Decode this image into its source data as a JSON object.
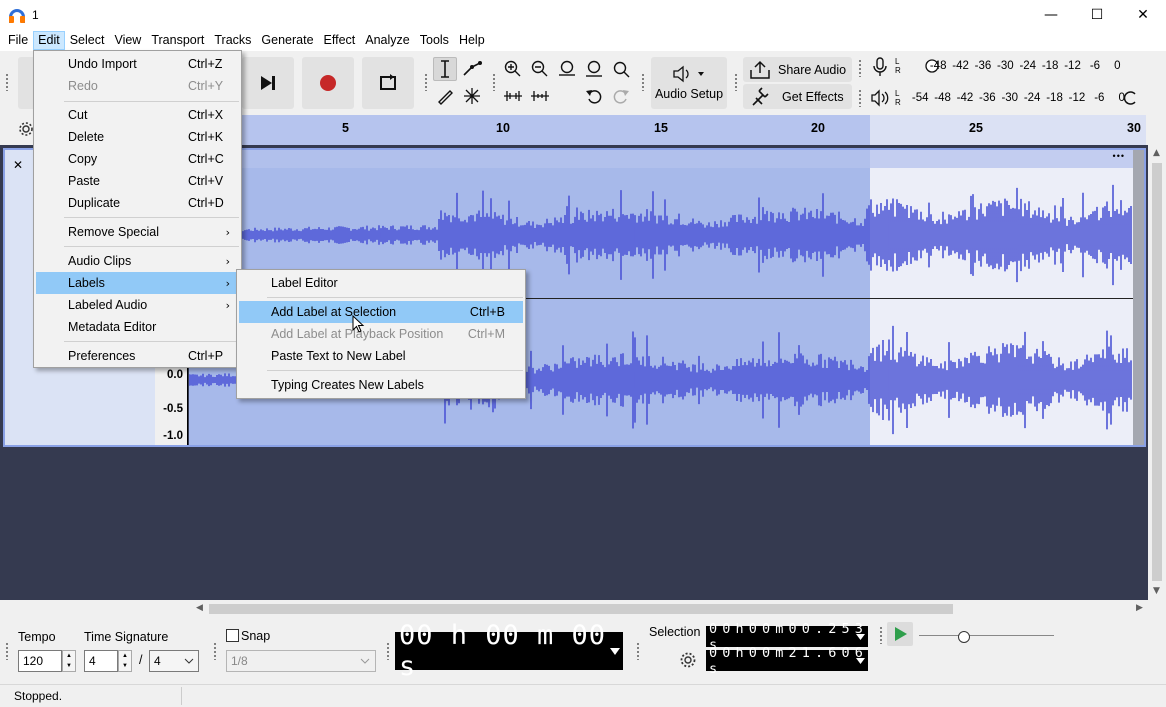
{
  "window": {
    "title": "1",
    "min_glyph": "—",
    "max_glyph": "☐",
    "close_glyph": "✕"
  },
  "menubar": [
    "File",
    "Edit",
    "Select",
    "View",
    "Transport",
    "Tracks",
    "Generate",
    "Effect",
    "Analyze",
    "Tools",
    "Help"
  ],
  "edit_menu": {
    "items": [
      {
        "label": "Undo Import",
        "shortcut": "Ctrl+Z",
        "disabled": false,
        "submenu": false
      },
      {
        "label": "Redo",
        "shortcut": "Ctrl+Y",
        "disabled": true,
        "submenu": false
      },
      {
        "label": "Cut",
        "shortcut": "Ctrl+X",
        "disabled": false,
        "submenu": false
      },
      {
        "label": "Delete",
        "shortcut": "Ctrl+K",
        "disabled": false,
        "submenu": false
      },
      {
        "label": "Copy",
        "shortcut": "Ctrl+C",
        "disabled": false,
        "submenu": false
      },
      {
        "label": "Paste",
        "shortcut": "Ctrl+V",
        "disabled": false,
        "submenu": false
      },
      {
        "label": "Duplicate",
        "shortcut": "Ctrl+D",
        "disabled": false,
        "submenu": false
      },
      {
        "label": "Remove Special",
        "shortcut": "",
        "disabled": false,
        "submenu": true
      },
      {
        "label": "Audio Clips",
        "shortcut": "",
        "disabled": false,
        "submenu": true
      },
      {
        "label": "Labels",
        "shortcut": "",
        "disabled": false,
        "submenu": true
      },
      {
        "label": "Labeled Audio",
        "shortcut": "",
        "disabled": false,
        "submenu": true
      },
      {
        "label": "Metadata Editor",
        "shortcut": "",
        "disabled": false,
        "submenu": false
      },
      {
        "label": "Preferences",
        "shortcut": "Ctrl+P",
        "disabled": false,
        "submenu": false
      }
    ]
  },
  "labels_submenu": {
    "items": [
      {
        "label": "Label Editor",
        "shortcut": "",
        "disabled": false
      },
      {
        "label": "Add Label at Selection",
        "shortcut": "Ctrl+B",
        "disabled": false
      },
      {
        "label": "Add Label at Playback Position",
        "shortcut": "Ctrl+M",
        "disabled": true
      },
      {
        "label": "Paste Text to New Label",
        "shortcut": "",
        "disabled": false
      },
      {
        "label": "Typing Creates New Labels",
        "shortcut": "",
        "disabled": false
      }
    ]
  },
  "toolbar": {
    "audio_setup": "Audio Setup",
    "share_audio": "Share Audio",
    "get_effects": "Get Effects",
    "record_meter_ticks": [
      "-48",
      "-42",
      "-36",
      "-30",
      "-24",
      "-18",
      "-12",
      "-6",
      "0"
    ],
    "play_meter_ticks": [
      "-54",
      "-48",
      "-42",
      "-36",
      "-30",
      "-24",
      "-18",
      "-12",
      "-6",
      "0"
    ],
    "meter_l": "L",
    "meter_r": "R"
  },
  "ruler": {
    "ticks": [
      "5",
      "10",
      "15",
      "20",
      "25",
      "30"
    ]
  },
  "track": {
    "vruler_labels": [
      "0.0",
      "-0.5",
      "-1.0"
    ],
    "close_glyph": "✕",
    "menu_glyph": "•••"
  },
  "bottom": {
    "tempo_label": "Tempo",
    "tempo_value": "120",
    "timesig_label": "Time Signature",
    "timesig_num": "4",
    "timesig_sep": "/",
    "timesig_den": "4",
    "snap_label": "Snap",
    "snap_value": "1/8",
    "time_display": "00 h 00 m 00 s",
    "selection_label": "Selection",
    "selection_start": "0 0 h 0 0 m 0 0 . 2 5 3 s",
    "selection_end": "0 0 h 0 0 m 2 1 . 6 0 6 s"
  },
  "status": {
    "text": "Stopped."
  }
}
